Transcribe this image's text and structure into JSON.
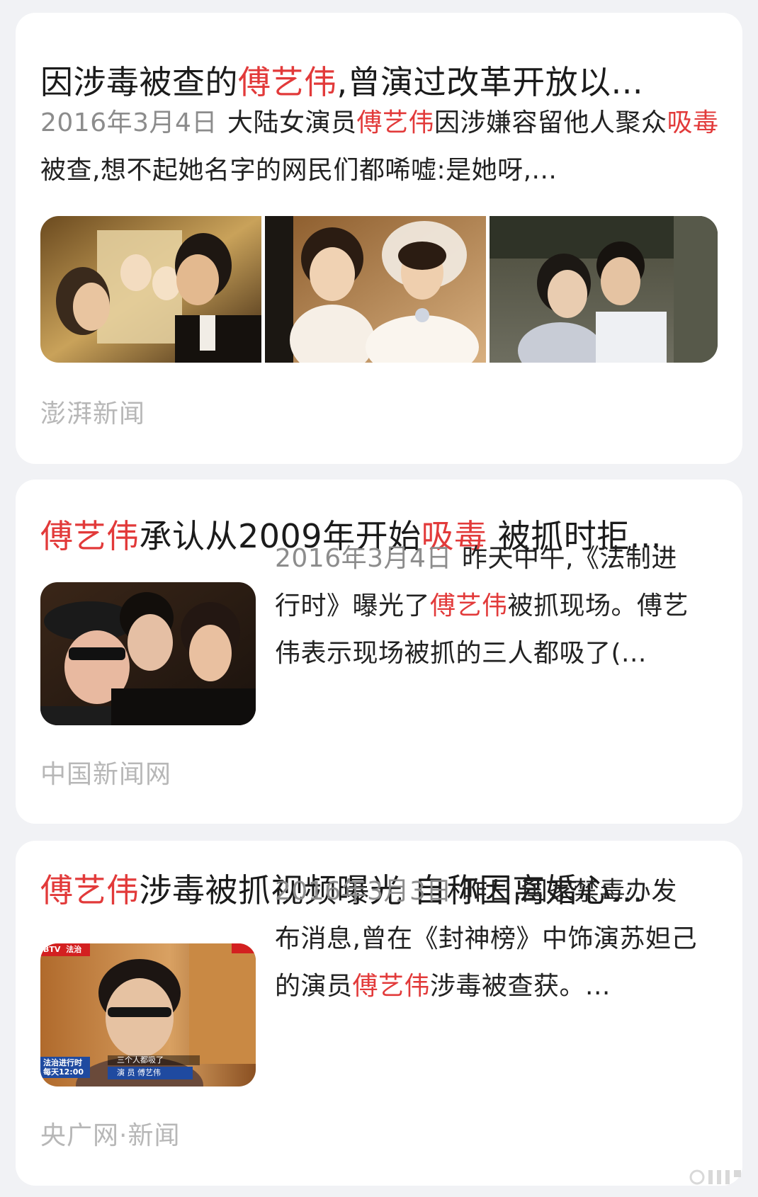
{
  "results": [
    {
      "title_parts": [
        {
          "text": "因涉毒被查的",
          "hl": false
        },
        {
          "text": "傅艺伟",
          "hl": true
        },
        {
          "text": ",曾演过改革开放以...",
          "hl": false
        }
      ],
      "date": "2016年3月4日",
      "snippet_parts": [
        {
          "text": "大陆女演员",
          "hl": false
        },
        {
          "text": "傅艺伟",
          "hl": true
        },
        {
          "text": "因涉嫌容留他人聚众",
          "hl": false
        },
        {
          "text": "吸毒",
          "hl": true
        },
        {
          "text": "被查,想不起她名字的网民们都唏嘘:是她呀,...",
          "hl": false
        }
      ],
      "images": [
        "wedding-portrait-image",
        "bride-photo-image",
        "couple-still-image"
      ],
      "source": "澎湃新闻"
    },
    {
      "title_parts": [
        {
          "text": "傅艺伟",
          "hl": true
        },
        {
          "text": "承认从2009年开始",
          "hl": false
        },
        {
          "text": "吸毒",
          "hl": true
        },
        {
          "text": " 被抓时拒...",
          "hl": false
        }
      ],
      "date": "2016年3月4日",
      "snippet_parts": [
        {
          "text": "昨天中午,《法制进行时》曝光了",
          "hl": false
        },
        {
          "text": "傅艺伟",
          "hl": true
        },
        {
          "text": "被抓现场。傅艺伟表示现场被抓的三人都吸了(...",
          "hl": false
        }
      ],
      "images": [
        "group-selfie-image"
      ],
      "source": "中国新闻网"
    },
    {
      "title_parts": [
        {
          "text": "傅艺伟",
          "hl": true
        },
        {
          "text": "涉毒被抓视频曝光 自称因离婚心...",
          "hl": false
        }
      ],
      "date": "2016年3月3日",
      "snippet_parts": [
        {
          "text": "昨日,国家禁毒办发布消息,曾在《封神榜》中饰演苏妲己的演员",
          "hl": false
        },
        {
          "text": "傅艺伟",
          "hl": true
        },
        {
          "text": "涉毒被查获。...",
          "hl": false
        }
      ],
      "images": [
        "tv-news-frame-image"
      ],
      "video_overlay": {
        "channel": "BTV",
        "tag": "法治",
        "program": "法治进行时",
        "time": "每天12:00",
        "subtitle": "三个人都吸了",
        "caption": "演 员  傅艺伟"
      },
      "source": "央广网·新闻"
    }
  ],
  "colors": {
    "highlight": "#e23a3a",
    "date": "#8c8c8c",
    "source": "#b7b7b7",
    "background": "#f1f2f5",
    "card": "#ffffff"
  }
}
